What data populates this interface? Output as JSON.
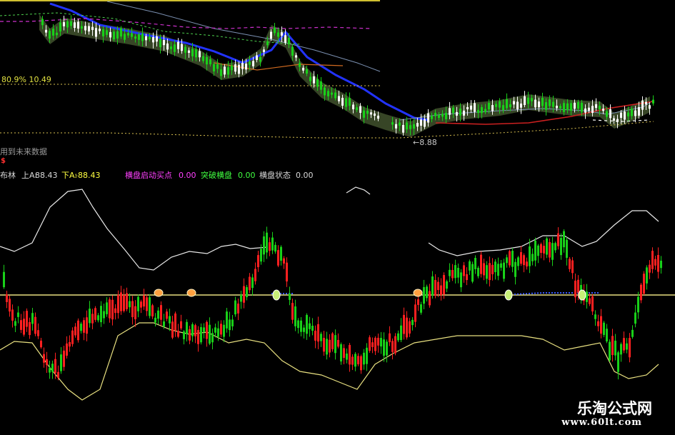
{
  "colors": {
    "background": "#000000",
    "up": "#ff2020",
    "down": "#19d019",
    "ma_blue": "#2233ff",
    "band": "#e8e080",
    "label_white": "#d8d8d8",
    "label_yellow": "#ffff40",
    "label_magenta": "#ff40ff",
    "label_green": "#40ff40",
    "marker": "#ffa040"
  },
  "main_panel": {
    "ratio_label": "80.9% 10.49",
    "low_price_label": "←8.88",
    "note": "用到未来数据",
    "s_marker": "$"
  },
  "indicator_bar": {
    "name": "布林",
    "upper_label": "上A:",
    "upper_value": "88.43",
    "lower_label": "下A:",
    "lower_value": "-88.43",
    "signal1_label": "横盘启动买点",
    "signal1_value": "0.00",
    "signal2_label": "突破横盘",
    "signal2_value": "0.00",
    "signal3_label": "横盘状态",
    "signal3_value": "0.00"
  },
  "watermark": {
    "title": "乐淘公式网",
    "url": "www.60lt.com"
  }
}
